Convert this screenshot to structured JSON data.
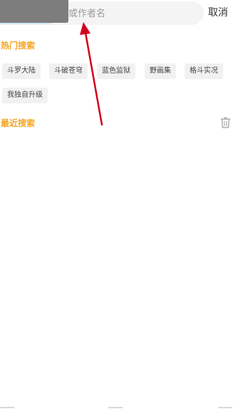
{
  "search": {
    "placeholder_visible": "或作者名",
    "cancel_label": "取消"
  },
  "hot_search": {
    "title": "热门搜索",
    "tags": [
      "斗罗大陆",
      "斗破苍穹",
      "蓝色监狱",
      "野画集",
      "格斗实况",
      "我独自升级"
    ]
  },
  "recent_search": {
    "title": "最近搜索"
  },
  "icons": {
    "trash": "trash-icon",
    "annotation_arrow": "red-arrow"
  },
  "colors": {
    "section_title": "#f5a623",
    "arrow": "#d0021b",
    "tag_bg": "#f1f1f1"
  }
}
